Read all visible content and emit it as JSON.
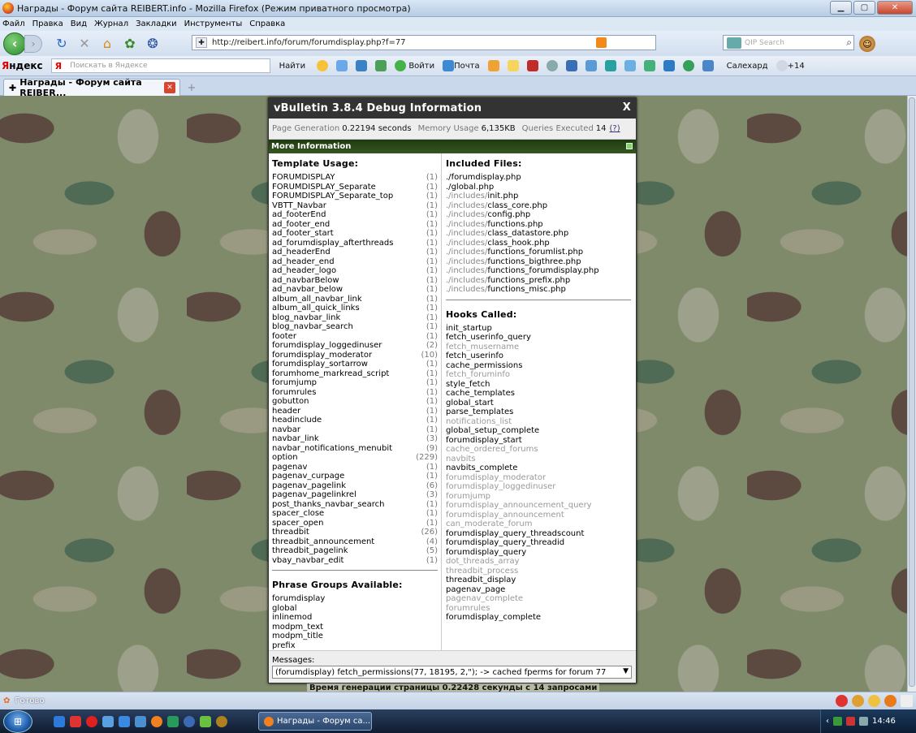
{
  "window": {
    "title": "Награды - Форум сайта REIBERT.info - Mozilla Firefox (Режим приватного просмотра)",
    "menu": [
      "Файл",
      "Правка",
      "Вид",
      "Журнал",
      "Закладки",
      "Инструменты",
      "Справка"
    ]
  },
  "nav": {
    "url": "http://reibert.info/forum/forumdisplay.php?f=77",
    "search_placeholder": "QIP Search"
  },
  "yandex": {
    "logo_ya": "Я",
    "logo_rest": "ндекс",
    "search_placeholder": "Поискать в Яндексе",
    "find_label": "Найти",
    "login_label": "Войти",
    "mail_label": "Почта",
    "city_label": "Салехард",
    "weather_label": "+14"
  },
  "tab": {
    "label": "Награды - Форум сайта REIBER..."
  },
  "debug": {
    "title": "vBulletin 3.8.4 Debug Information",
    "close": "X",
    "gen_label": "Page Generation",
    "gen_value": "0.22194 seconds",
    "mem_label": "Memory Usage",
    "mem_value": "6,135KB",
    "q_label": "Queries Executed",
    "q_value": "14",
    "q_help": "(?)",
    "more_label": "More Information",
    "template_heading": "Template Usage:",
    "templates": [
      {
        "name": "FORUMDISPLAY",
        "count": "(1)"
      },
      {
        "name": "FORUMDISPLAY_Separate",
        "count": "(1)"
      },
      {
        "name": "FORUMDISPLAY_Separate_top",
        "count": "(1)"
      },
      {
        "name": "VBTT_Navbar",
        "count": "(1)"
      },
      {
        "name": "ad_footerEnd",
        "count": "(1)"
      },
      {
        "name": "ad_footer_end",
        "count": "(1)"
      },
      {
        "name": "ad_footer_start",
        "count": "(1)"
      },
      {
        "name": "ad_forumdisplay_afterthreads",
        "count": "(1)"
      },
      {
        "name": "ad_headerEnd",
        "count": "(1)"
      },
      {
        "name": "ad_header_end",
        "count": "(1)"
      },
      {
        "name": "ad_header_logo",
        "count": "(1)"
      },
      {
        "name": "ad_navbarBelow",
        "count": "(1)"
      },
      {
        "name": "ad_navbar_below",
        "count": "(1)"
      },
      {
        "name": "album_all_navbar_link",
        "count": "(1)"
      },
      {
        "name": "album_all_quick_links",
        "count": "(1)"
      },
      {
        "name": "blog_navbar_link",
        "count": "(1)"
      },
      {
        "name": "blog_navbar_search",
        "count": "(1)"
      },
      {
        "name": "footer",
        "count": "(1)"
      },
      {
        "name": "forumdisplay_loggedinuser",
        "count": "(2)"
      },
      {
        "name": "forumdisplay_moderator",
        "count": "(10)"
      },
      {
        "name": "forumdisplay_sortarrow",
        "count": "(1)"
      },
      {
        "name": "forumhome_markread_script",
        "count": "(1)"
      },
      {
        "name": "forumjump",
        "count": "(1)"
      },
      {
        "name": "forumrules",
        "count": "(1)"
      },
      {
        "name": "gobutton",
        "count": "(1)"
      },
      {
        "name": "header",
        "count": "(1)"
      },
      {
        "name": "headinclude",
        "count": "(1)"
      },
      {
        "name": "navbar",
        "count": "(1)"
      },
      {
        "name": "navbar_link",
        "count": "(3)"
      },
      {
        "name": "navbar_notifications_menubit",
        "count": "(9)"
      },
      {
        "name": "option",
        "count": "(229)"
      },
      {
        "name": "pagenav",
        "count": "(1)"
      },
      {
        "name": "pagenav_curpage",
        "count": "(1)"
      },
      {
        "name": "pagenav_pagelink",
        "count": "(6)"
      },
      {
        "name": "pagenav_pagelinkrel",
        "count": "(3)"
      },
      {
        "name": "post_thanks_navbar_search",
        "count": "(1)"
      },
      {
        "name": "spacer_close",
        "count": "(1)"
      },
      {
        "name": "spacer_open",
        "count": "(1)"
      },
      {
        "name": "threadbit",
        "count": "(26)"
      },
      {
        "name": "threadbit_announcement",
        "count": "(4)"
      },
      {
        "name": "threadbit_pagelink",
        "count": "(5)"
      },
      {
        "name": "vbay_navbar_edit",
        "count": "(1)"
      }
    ],
    "phrase_heading": "Phrase Groups Available:",
    "phrases": [
      "forumdisplay",
      "global",
      "inlinemod",
      "modpm_text",
      "modpm_title",
      "prefix"
    ],
    "files_heading": "Included Files:",
    "files": [
      {
        "dir": "./",
        "file": "forumdisplay.php"
      },
      {
        "dir": "./",
        "file": "global.php"
      },
      {
        "dir": "./includes/",
        "file": "init.php"
      },
      {
        "dir": "./includes/",
        "file": "class_core.php"
      },
      {
        "dir": "./includes/",
        "file": "config.php"
      },
      {
        "dir": "./includes/",
        "file": "functions.php"
      },
      {
        "dir": "./includes/",
        "file": "class_datastore.php"
      },
      {
        "dir": "./includes/",
        "file": "class_hook.php"
      },
      {
        "dir": "./includes/",
        "file": "functions_forumlist.php"
      },
      {
        "dir": "./includes/",
        "file": "functions_bigthree.php"
      },
      {
        "dir": "./includes/",
        "file": "functions_forumdisplay.php"
      },
      {
        "dir": "./includes/",
        "file": "functions_prefix.php"
      },
      {
        "dir": "./includes/",
        "file": "functions_misc.php"
      }
    ],
    "hooks_heading": "Hooks Called:",
    "hooks": [
      {
        "name": "init_startup",
        "active": true
      },
      {
        "name": "fetch_userinfo_query",
        "active": true
      },
      {
        "name": "fetch_musername",
        "active": false
      },
      {
        "name": "fetch_userinfo",
        "active": true
      },
      {
        "name": "cache_permissions",
        "active": true
      },
      {
        "name": "fetch_foruminfo",
        "active": false
      },
      {
        "name": "style_fetch",
        "active": true
      },
      {
        "name": "cache_templates",
        "active": true
      },
      {
        "name": "global_start",
        "active": true
      },
      {
        "name": "parse_templates",
        "active": true
      },
      {
        "name": "notifications_list",
        "active": false
      },
      {
        "name": "global_setup_complete",
        "active": true
      },
      {
        "name": "forumdisplay_start",
        "active": true
      },
      {
        "name": "cache_ordered_forums",
        "active": false
      },
      {
        "name": "navbits",
        "active": false
      },
      {
        "name": "navbits_complete",
        "active": true
      },
      {
        "name": "forumdisplay_moderator",
        "active": false
      },
      {
        "name": "forumdisplay_loggedinuser",
        "active": false
      },
      {
        "name": "forumjump",
        "active": false
      },
      {
        "name": "forumdisplay_announcement_query",
        "active": false
      },
      {
        "name": "forumdisplay_announcement",
        "active": false
      },
      {
        "name": "can_moderate_forum",
        "active": false
      },
      {
        "name": "forumdisplay_query_threadscount",
        "active": true
      },
      {
        "name": "forumdisplay_query_threadid",
        "active": true
      },
      {
        "name": "forumdisplay_query",
        "active": true
      },
      {
        "name": "dot_threads_array",
        "active": false
      },
      {
        "name": "threadbit_process",
        "active": false
      },
      {
        "name": "threadbit_display",
        "active": true
      },
      {
        "name": "pagenav_page",
        "active": true
      },
      {
        "name": "pagenav_complete",
        "active": false
      },
      {
        "name": "forumrules",
        "active": false
      },
      {
        "name": "forumdisplay_complete",
        "active": true
      }
    ],
    "messages_label": "Messages:",
    "message_selected": "(forumdisplay) fetch_permissions(77, 18195, 2,\"); -> cached fperms for forum 77"
  },
  "page_footer": "Время генерации страницы 0.22428 секунды с 14 запросами",
  "status": {
    "text": "Готово"
  },
  "taskbar": {
    "task_label": "Награды - Форум са...",
    "clock": "14:46"
  }
}
